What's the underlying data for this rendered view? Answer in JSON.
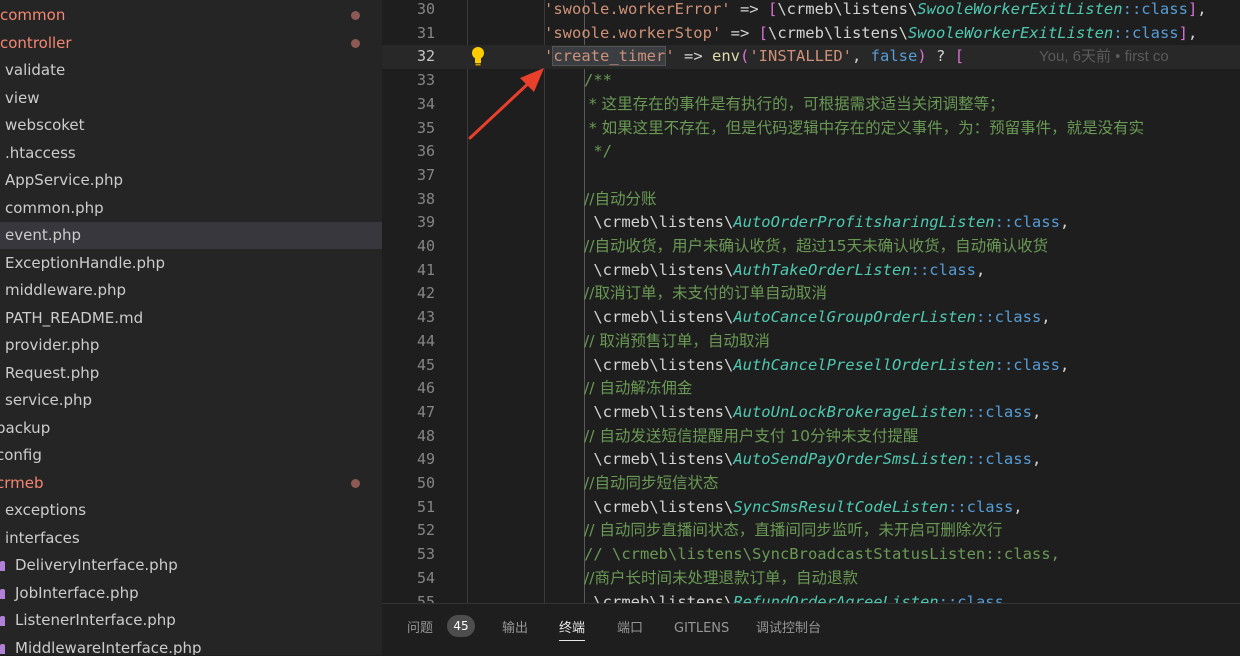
{
  "sidebar": {
    "items": [
      {
        "label": "common",
        "color": "red",
        "modified": true
      },
      {
        "label": "controller",
        "color": "red",
        "modified": true
      },
      {
        "label": "validate"
      },
      {
        "label": "view"
      },
      {
        "label": "webscoket"
      },
      {
        "label": ".htaccess"
      },
      {
        "label": "AppService.php"
      },
      {
        "label": "common.php"
      },
      {
        "label": "event.php",
        "selected": true
      },
      {
        "label": "ExceptionHandle.php"
      },
      {
        "label": "middleware.php"
      },
      {
        "label": "PATH_README.md"
      },
      {
        "label": "provider.php"
      },
      {
        "label": "Request.php"
      },
      {
        "label": "service.php"
      },
      {
        "label": "backup"
      },
      {
        "label": "config"
      },
      {
        "label": "crmeb",
        "color": "red",
        "modified": true
      },
      {
        "label": "exceptions"
      },
      {
        "label": "interfaces"
      },
      {
        "label": "DeliveryInterface.php",
        "icon": "php-interface-icon"
      },
      {
        "label": "JobInterface.php",
        "icon": "php-interface-icon"
      },
      {
        "label": "ListenerInterface.php",
        "icon": "php-interface-icon"
      },
      {
        "label": "MiddlewareInterface.php",
        "icon": "php-interface-icon"
      }
    ]
  },
  "editor": {
    "lines": [
      {
        "n": "30",
        "code": [
          [
            "str",
            "'swoole.workerError'"
          ],
          [
            "op",
            " => "
          ],
          [
            "brk",
            "["
          ],
          [
            "ns",
            "\\crmeb\\listens\\"
          ],
          [
            "cls",
            "SwooleWorkerExitListen"
          ],
          [
            "kw",
            "::class"
          ],
          [
            "brk",
            "]"
          ],
          [
            "op",
            ","
          ]
        ]
      },
      {
        "n": "31",
        "code": [
          [
            "str",
            "'swoole.workerStop'"
          ],
          [
            "op",
            " => "
          ],
          [
            "brk",
            "["
          ],
          [
            "ns",
            "\\crmeb\\listens\\"
          ],
          [
            "cls",
            "SwooleWorkerExitListen"
          ],
          [
            "kw",
            "::class"
          ],
          [
            "brk",
            "]"
          ],
          [
            "op",
            ","
          ]
        ]
      },
      {
        "n": "32",
        "current": true,
        "code": [
          [
            "str",
            "'"
          ],
          [
            "strhl",
            "create_timer"
          ],
          [
            "str",
            "'"
          ],
          [
            "op",
            " => "
          ],
          [
            "fn",
            "env"
          ],
          [
            "brk",
            "("
          ],
          [
            "str",
            "'INSTALLED'"
          ],
          [
            "op",
            ", "
          ],
          [
            "kw",
            "false"
          ],
          [
            "brk",
            ")"
          ],
          [
            "op",
            " ? "
          ],
          [
            "brk",
            "["
          ]
        ],
        "blame": "You, 6天前 • first co"
      },
      {
        "n": "33",
        "code": [
          [
            "cmt",
            "/**"
          ]
        ]
      },
      {
        "n": "34",
        "code": [
          [
            "cmt",
            " * 这里存在的事件是有执行的，可根据需求适当关闭调整等；"
          ]
        ]
      },
      {
        "n": "35",
        "code": [
          [
            "cmt",
            " * 如果这里不存在，但是代码逻辑中存在的定义事件，为：预留事件，就是没有实"
          ]
        ]
      },
      {
        "n": "36",
        "code": [
          [
            "cmt",
            " */"
          ]
        ]
      },
      {
        "n": "37",
        "code": []
      },
      {
        "n": "38",
        "code": [
          [
            "cmt",
            "//自动分账"
          ]
        ]
      },
      {
        "n": "39",
        "code": [
          [
            "ns",
            " \\crmeb\\listens\\"
          ],
          [
            "cls",
            "AutoOrderProfitsharingListen"
          ],
          [
            "kw",
            "::class"
          ],
          [
            "op",
            ","
          ]
        ]
      },
      {
        "n": "40",
        "code": [
          [
            "cmt",
            "//自动收货，用户未确认收货，超过15天未确认收货，自动确认收货"
          ]
        ]
      },
      {
        "n": "41",
        "code": [
          [
            "ns",
            " \\crmeb\\listens\\"
          ],
          [
            "cls",
            "AuthTakeOrderListen"
          ],
          [
            "kw",
            "::class"
          ],
          [
            "op",
            ","
          ]
        ]
      },
      {
        "n": "42",
        "code": [
          [
            "cmt",
            "//取消订单，未支付的订单自动取消"
          ]
        ]
      },
      {
        "n": "43",
        "code": [
          [
            "ns",
            " \\crmeb\\listens\\"
          ],
          [
            "cls",
            "AutoCancelGroupOrderListen"
          ],
          [
            "kw",
            "::class"
          ],
          [
            "op",
            ","
          ]
        ]
      },
      {
        "n": "44",
        "code": [
          [
            "cmt",
            "// 取消预售订单，自动取消"
          ]
        ]
      },
      {
        "n": "45",
        "code": [
          [
            "ns",
            " \\crmeb\\listens\\"
          ],
          [
            "cls",
            "AuthCancelPresellOrderListen"
          ],
          [
            "kw",
            "::class"
          ],
          [
            "op",
            ","
          ]
        ]
      },
      {
        "n": "46",
        "code": [
          [
            "cmt",
            "// 自动解冻佣金"
          ]
        ]
      },
      {
        "n": "47",
        "code": [
          [
            "ns",
            " \\crmeb\\listens\\"
          ],
          [
            "cls",
            "AutoUnLockBrokerageListen"
          ],
          [
            "kw",
            "::class"
          ],
          [
            "op",
            ","
          ]
        ]
      },
      {
        "n": "48",
        "code": [
          [
            "cmt",
            "// 自动发送短信提醒用户支付 10分钟未支付提醒"
          ]
        ]
      },
      {
        "n": "49",
        "code": [
          [
            "ns",
            " \\crmeb\\listens\\"
          ],
          [
            "cls",
            "AutoSendPayOrderSmsListen"
          ],
          [
            "kw",
            "::class"
          ],
          [
            "op",
            ","
          ]
        ]
      },
      {
        "n": "50",
        "code": [
          [
            "cmt",
            "//自动同步短信状态"
          ]
        ]
      },
      {
        "n": "51",
        "code": [
          [
            "ns",
            " \\crmeb\\listens\\"
          ],
          [
            "cls",
            "SyncSmsResultCodeListen"
          ],
          [
            "kw",
            "::class"
          ],
          [
            "op",
            ","
          ]
        ]
      },
      {
        "n": "52",
        "code": [
          [
            "cmt",
            "// 自动同步直播间状态，直播间同步监听，未开启可删除次行"
          ]
        ]
      },
      {
        "n": "53",
        "code": [
          [
            "cmt",
            "// \\crmeb\\listens\\SyncBroadcastStatusListen::class,"
          ]
        ]
      },
      {
        "n": "54",
        "code": [
          [
            "cmt",
            "//商户长时间未处理退款订单，自动退款"
          ]
        ]
      },
      {
        "n": "55",
        "code": [
          [
            "ns",
            " \\crmeb\\listens\\"
          ],
          [
            "cls",
            "RefundOrderAgreeListen"
          ],
          [
            "kw",
            "::class"
          ],
          [
            "op",
            ","
          ]
        ]
      }
    ]
  },
  "panel": {
    "tabs": [
      {
        "label": "问题",
        "badge": "45"
      },
      {
        "label": "输出"
      },
      {
        "label": "终端",
        "active": true
      },
      {
        "label": "端口"
      },
      {
        "label": "GITLENS"
      },
      {
        "label": "调试控制台"
      }
    ]
  },
  "icons": {
    "lightbulb": "lightbulb-icon",
    "arrow": "annotation-arrow"
  },
  "colors": {
    "accent_red": "#f48771",
    "arrow_red": "#e8402a",
    "bulb": "#ffcc00"
  }
}
